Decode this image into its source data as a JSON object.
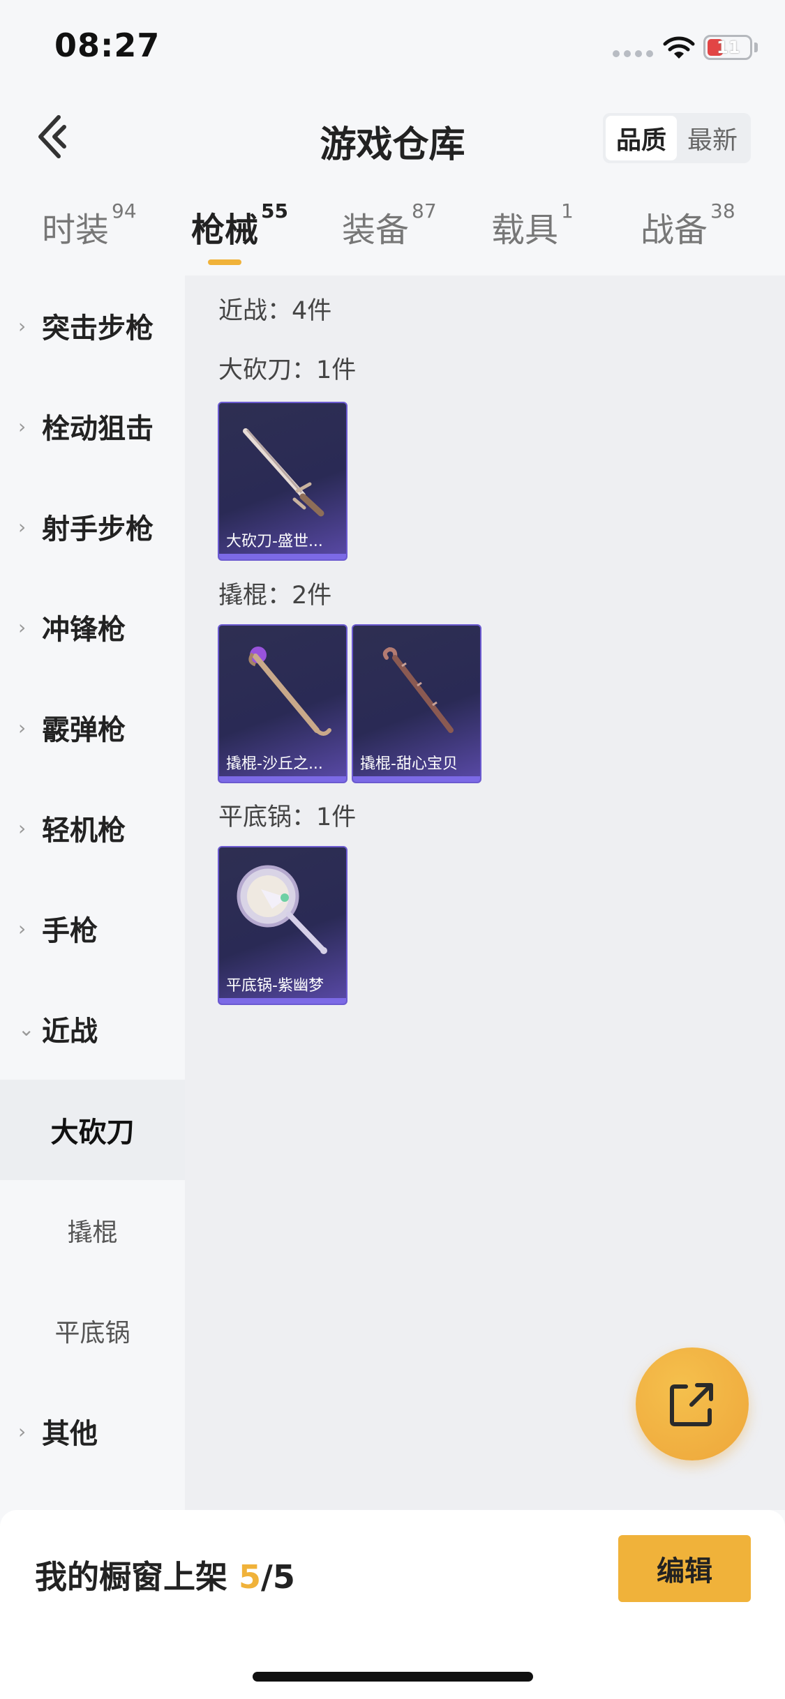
{
  "status_bar": {
    "time": "08:27",
    "battery": "11"
  },
  "header": {
    "title": "游戏仓库",
    "sort_options": [
      "品质",
      "最新"
    ],
    "active_sort": "品质"
  },
  "tabs": [
    {
      "label": "时装",
      "count": "94"
    },
    {
      "label": "枪械",
      "count": "55",
      "active": true
    },
    {
      "label": "装备",
      "count": "87"
    },
    {
      "label": "载具",
      "count": "1"
    },
    {
      "label": "战备",
      "count": "38"
    }
  ],
  "sidebar": {
    "categories": [
      {
        "label": "突击步枪",
        "chevron": "›"
      },
      {
        "label": "栓动狙击",
        "chevron": "›"
      },
      {
        "label": "射手步枪",
        "chevron": "›"
      },
      {
        "label": "冲锋枪",
        "chevron": "›"
      },
      {
        "label": "霰弹枪",
        "chevron": "›"
      },
      {
        "label": "轻机枪",
        "chevron": "›"
      },
      {
        "label": "手枪",
        "chevron": "›"
      },
      {
        "label": "近战",
        "chevron": "⌄"
      }
    ],
    "subcategories": [
      {
        "label": "大砍刀",
        "active": true
      },
      {
        "label": "撬棍"
      },
      {
        "label": "平底锅"
      }
    ],
    "other": {
      "label": "其他",
      "chevron": "›"
    }
  },
  "content": {
    "summary": "近战：4件",
    "groups": [
      {
        "label": "大砍刀：1件",
        "items": [
          {
            "name": "大砍刀-盛世...",
            "icon": "machete-icon"
          }
        ]
      },
      {
        "label": "撬棍：2件",
        "items": [
          {
            "name": "撬棍-沙丘之...",
            "icon": "crowbar-icon"
          },
          {
            "name": "撬棍-甜心宝贝",
            "icon": "crowbar-icon"
          }
        ]
      },
      {
        "label": "平底锅：1件",
        "items": [
          {
            "name": "平底锅-紫幽梦",
            "icon": "frying-pan-icon"
          }
        ]
      }
    ]
  },
  "bottom_bar": {
    "shelf_label": "我的橱窗上架 ",
    "shelf_current": "5",
    "shelf_total": "/5",
    "edit_label": "编辑"
  },
  "colors": {
    "accent": "#f0b23a",
    "card_bg": "#2a2a55",
    "card_border": "#6b5ad0"
  }
}
